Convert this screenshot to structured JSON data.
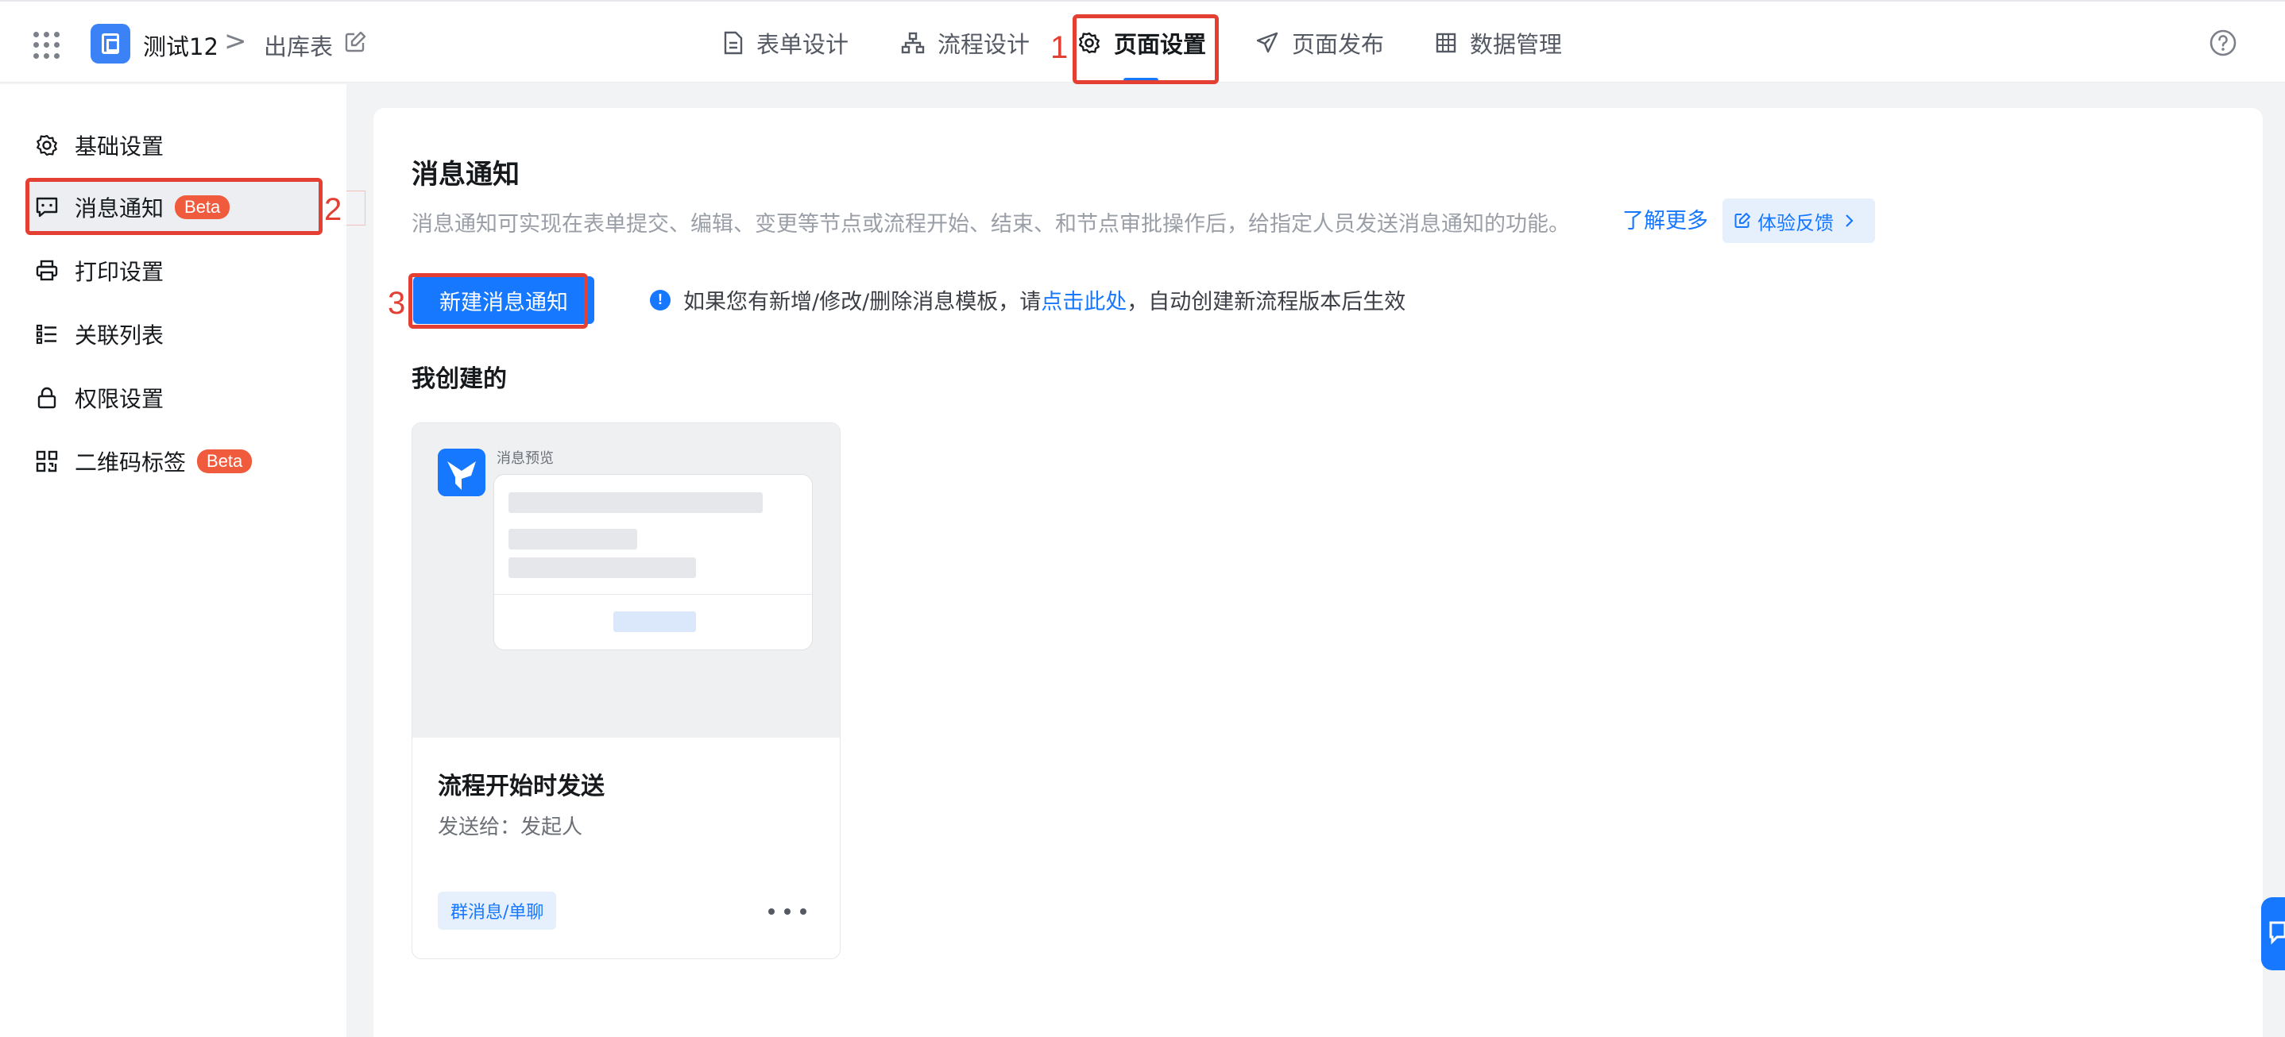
{
  "header": {
    "app_name": "测试12",
    "breadcrumb_separator": ">",
    "page_name": "出库表",
    "tabs": [
      {
        "label": "表单设计",
        "icon": "form-doc-icon"
      },
      {
        "label": "流程设计",
        "icon": "flow-icon"
      },
      {
        "label": "页面设置",
        "icon": "gear-icon",
        "active": true
      },
      {
        "label": "页面发布",
        "icon": "send-icon"
      },
      {
        "label": "数据管理",
        "icon": "table-icon"
      }
    ],
    "help_icon": "help-circle-icon"
  },
  "annotations": [
    "1",
    "2",
    "3"
  ],
  "sidebar": {
    "items": [
      {
        "label": "基础设置",
        "icon": "gear-icon"
      },
      {
        "label": "消息通知",
        "icon": "message-icon",
        "badge": "Beta",
        "active": true
      },
      {
        "label": "打印设置",
        "icon": "printer-icon"
      },
      {
        "label": "关联列表",
        "icon": "list-icon"
      },
      {
        "label": "权限设置",
        "icon": "lock-icon"
      },
      {
        "label": "二维码标签",
        "icon": "qrcode-icon",
        "badge": "Beta"
      }
    ]
  },
  "main": {
    "title": "消息通知",
    "description": "消息通知可实现在表单提交、编辑、变更等节点或流程开始、结束、和节点审批操作后，给指定人员发送消息通知的功能。",
    "learn_more": "了解更多",
    "feedback_label": "体验反馈",
    "new_button": "新建消息通知",
    "notice_prefix": "如果您有新增/修改/删除消息模板，请",
    "notice_link": "点击此处",
    "notice_suffix": "，自动创建新流程版本后生效",
    "section_title": "我创建的",
    "cards": [
      {
        "preview_label": "消息预览",
        "title": "流程开始时发送",
        "subtitle": "发送给：发起人",
        "tag": "群消息/单聊"
      }
    ]
  },
  "colors": {
    "primary": "#1677ff",
    "annotation_red": "#e34033",
    "beta_badge": "#ef5b3c"
  }
}
